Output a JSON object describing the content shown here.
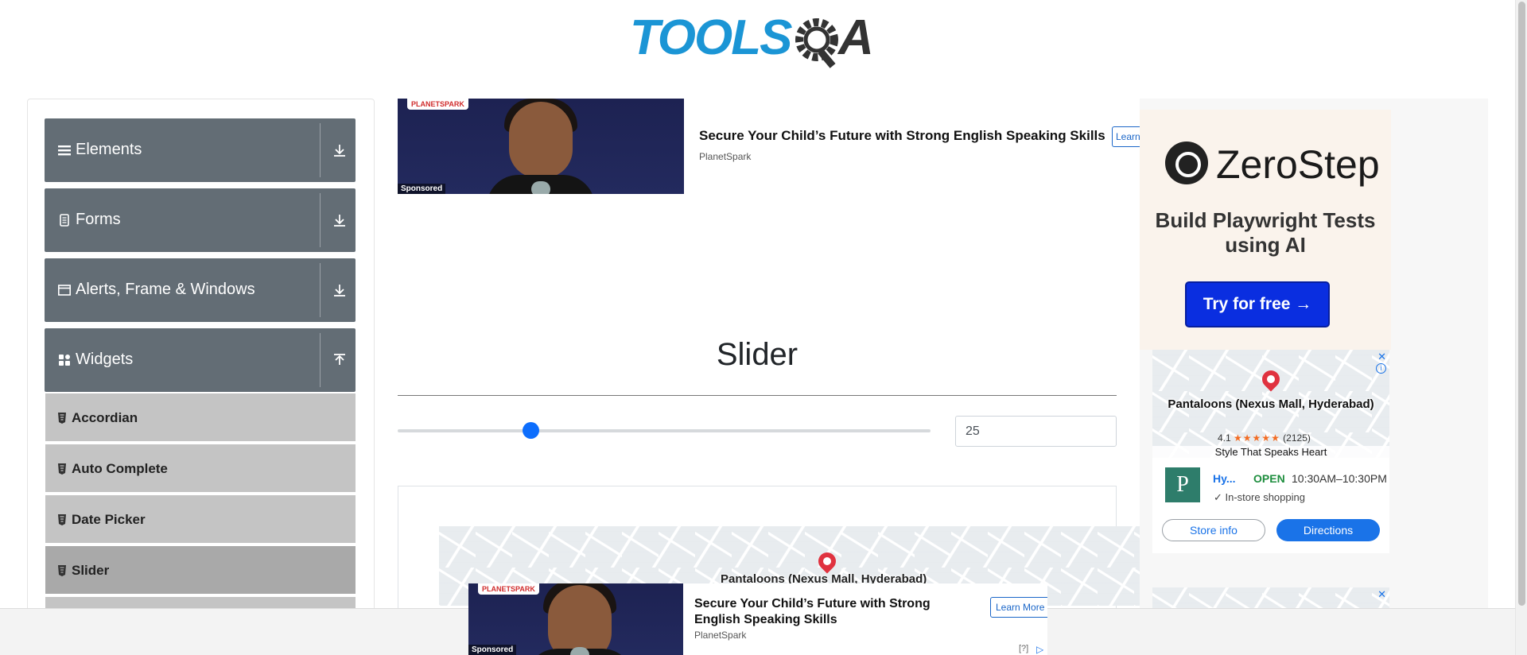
{
  "header": {
    "logo_text": "TOOLSQA",
    "logo_left": "TOOLS",
    "logo_right": "A"
  },
  "sidebar": {
    "groups": [
      {
        "label": "Elements",
        "icon": "hamburger-icon",
        "arrow": "download-icon"
      },
      {
        "label": "Forms",
        "icon": "form-icon",
        "arrow": "download-icon"
      },
      {
        "label": "Alerts, Frame & Windows",
        "icon": "window-icon",
        "arrow": "download-icon"
      },
      {
        "label": "Widgets",
        "icon": "widgets-icon",
        "arrow": "upload-icon"
      }
    ],
    "widget_items": [
      {
        "label": "Accordian"
      },
      {
        "label": "Auto Complete"
      },
      {
        "label": "Date Picker"
      },
      {
        "label": "Slider",
        "active": true
      }
    ]
  },
  "top_ad": {
    "brand": "PLANETSPARK",
    "sponsored": "Sponsored",
    "title": "Secure Your Child’s Future with Strong English Speaking Skills",
    "advertiser": "PlanetSpark",
    "button": "Learn"
  },
  "main": {
    "title": "Slider",
    "slider": {
      "value": "25",
      "min": 0,
      "max": 100
    }
  },
  "center_map": {
    "label": "Pantaloons (Nexus Mall, Hyderabad)"
  },
  "right_ad": {
    "zerostep": {
      "name": "ZeroStep",
      "headline": "Build Playwright Tests using AI",
      "button": "Try for free →"
    },
    "store": {
      "name": "Pantaloons (Nexus Mall, Hyderabad)",
      "rating": "4.1",
      "stars": "★★★★★",
      "reviews": "(2125)",
      "tagline": "Style That Speaks Heart",
      "short": "Hy...",
      "status": "OPEN",
      "hours": "10:30AM–10:30PM",
      "feature": "✓ In-store shopping",
      "logo": "P",
      "store_info": "Store info",
      "directions": "Directions",
      "close": "✕",
      "info": "i"
    },
    "store2": {
      "close": "✕"
    }
  },
  "bottom_ad": {
    "brand": "PLANETSPARK",
    "sponsored": "Sponsored",
    "title": "Secure Your Child’s Future with Strong English Speaking Skills",
    "advertiser": "PlanetSpark",
    "button": "Learn More",
    "adchoices": "[?]",
    "adchoices_icon": "▷"
  },
  "colors": {
    "accent": "#1b95d5",
    "sidebar_group": "#636d75",
    "sidebar_item": "#c4c4c4",
    "slider_thumb": "#0d6efd"
  }
}
